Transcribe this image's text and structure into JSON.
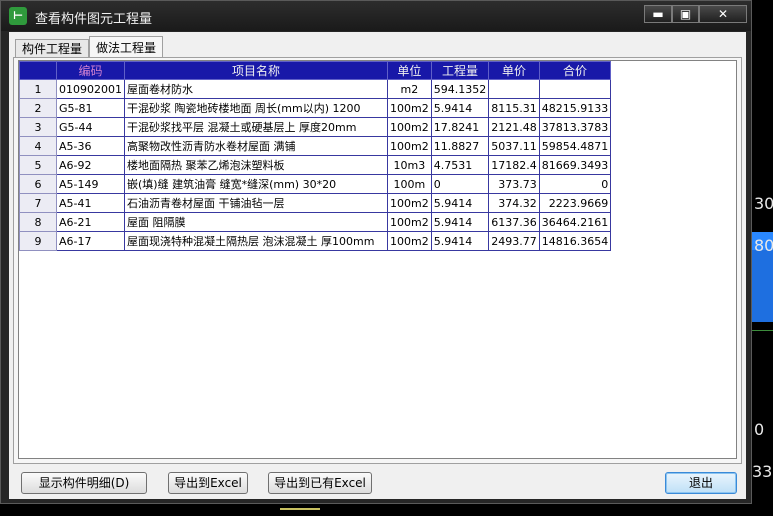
{
  "window": {
    "title": "查看构件图元工程量"
  },
  "window_controls": {
    "minimize": "▬",
    "maximize": "▣",
    "close": "✕"
  },
  "app_icon_glyph": "⊢",
  "tabs": [
    {
      "label": "构件工程量",
      "active": false
    },
    {
      "label": "做法工程量",
      "active": true
    }
  ],
  "table": {
    "headers": [
      "",
      "编码",
      "项目名称",
      "单位",
      "工程量",
      "单价",
      "合价"
    ],
    "rows": [
      [
        "1",
        "010902001",
        "屋面卷材防水",
        "m2",
        "594.1352",
        "",
        ""
      ],
      [
        "2",
        "G5-81",
        "干混砂浆 陶瓷地砖楼地面 周长(mm以内) 1200",
        "100m2",
        "5.9414",
        "8115.31",
        "48215.9133"
      ],
      [
        "3",
        "G5-44",
        "干混砂浆找平层 混凝土或硬基层上 厚度20mm",
        "100m2",
        "17.8241",
        "2121.48",
        "37813.3783"
      ],
      [
        "4",
        "A5-36",
        "高聚物改性沥青防水卷材屋面 满铺",
        "100m2",
        "11.8827",
        "5037.11",
        "59854.4871"
      ],
      [
        "5",
        "A6-92",
        "楼地面隔热 聚苯乙烯泡沫塑料板",
        "10m3",
        "4.7531",
        "17182.4",
        "81669.3493"
      ],
      [
        "6",
        "A5-149",
        "嵌(填)缝 建筑油膏 缝宽*缝深(mm) 30*20",
        "100m",
        "0",
        "373.73",
        "0"
      ],
      [
        "7",
        "A5-41",
        "石油沥青卷材屋面 干铺油毡一层",
        "100m2",
        "5.9414",
        "374.32",
        "2223.9669"
      ],
      [
        "8",
        "A6-21",
        "屋面 阻隔膜",
        "100m2",
        "5.9414",
        "6137.36",
        "36464.2161"
      ],
      [
        "9",
        "A6-17",
        "屋面现浇特种混凝土隔热层 泡沫混凝土 厚100mm",
        "100m2",
        "5.9414",
        "2493.77",
        "14816.3654"
      ]
    ]
  },
  "buttons": {
    "show_detail": "显示构件明细(D)",
    "export_excel": "导出到Excel",
    "export_existing_excel": "导出到已有Excel",
    "exit": "退出"
  },
  "background_numbers": [
    "30",
    "80",
    "0",
    "33"
  ],
  "colors": {
    "header_bg": "#1818a8",
    "code_header": "#d080d0",
    "accent_button": "#3a8ad8"
  }
}
